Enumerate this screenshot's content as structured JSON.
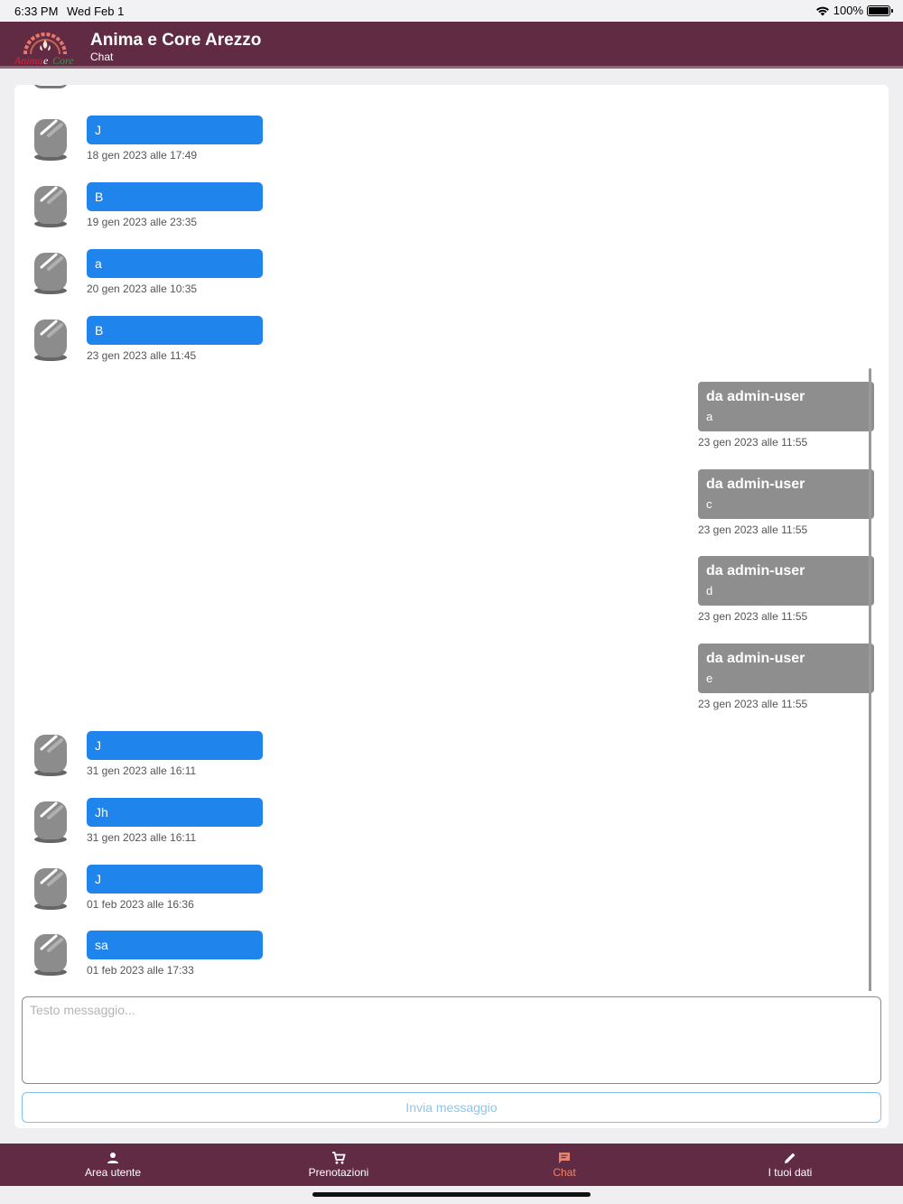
{
  "status_bar": {
    "time": "6:33 PM",
    "date": "Wed Feb 1",
    "battery": "100%"
  },
  "header": {
    "title": "Anima e Core Arezzo",
    "subtitle": "Chat",
    "logo_text": "Anima e Core"
  },
  "messages_in": [
    {
      "text": "J",
      "timestamp": "18 gen 2023 alle 17:49"
    },
    {
      "text": "B",
      "timestamp": "19 gen 2023 alle 23:35"
    },
    {
      "text": "a",
      "timestamp": "20 gen 2023 alle 10:35"
    },
    {
      "text": "B",
      "timestamp": "23 gen 2023 alle 11:45"
    }
  ],
  "messages_out": [
    {
      "from": "da admin-user",
      "text": "a",
      "timestamp": "23 gen 2023 alle 11:55"
    },
    {
      "from": "da admin-user",
      "text": "c",
      "timestamp": "23 gen 2023 alle 11:55"
    },
    {
      "from": "da admin-user",
      "text": "d",
      "timestamp": "23 gen 2023 alle 11:55"
    },
    {
      "from": "da admin-user",
      "text": "e",
      "timestamp": "23 gen 2023 alle 11:55"
    }
  ],
  "messages_in_2": [
    {
      "text": "J",
      "timestamp": "31 gen 2023 alle 16:11"
    },
    {
      "text": "Jh",
      "timestamp": "31 gen 2023 alle 16:11"
    },
    {
      "text": "J",
      "timestamp": "01 feb 2023 alle 16:36"
    },
    {
      "text": "sa",
      "timestamp": "01 feb 2023 alle 17:33"
    }
  ],
  "composer": {
    "placeholder": "Testo messaggio...",
    "send_label": "Invia messaggio"
  },
  "tabs": [
    {
      "label": "Area utente",
      "icon": "person-icon"
    },
    {
      "label": "Prenotazioni",
      "icon": "cart-icon"
    },
    {
      "label": "Chat",
      "icon": "chat-icon",
      "active": true
    },
    {
      "label": "I tuoi dati",
      "icon": "pencil-icon"
    }
  ],
  "colors": {
    "brand": "#622b44",
    "bubble_user": "#1f85ec",
    "bubble_admin": "#8e8e8e",
    "tab_active": "#f08264"
  }
}
